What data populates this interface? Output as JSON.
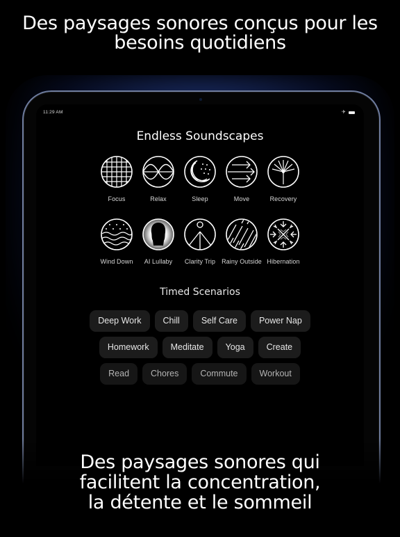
{
  "marketing": {
    "top_headline": "Des paysages sonores conçus pour les\nbesoins quotidiens",
    "bottom_headline": "Des paysages sonores qui\nfacilitent la concentration,\nla détente et le sommeil"
  },
  "status_bar": {
    "time": "11:29 AM",
    "icons": [
      "airplane-icon",
      "battery-icon"
    ]
  },
  "soundscapes": {
    "title": "Endless Soundscapes",
    "items": [
      {
        "label": "Focus",
        "icon": "grid-globe-icon"
      },
      {
        "label": "Relax",
        "icon": "wave-icon"
      },
      {
        "label": "Sleep",
        "icon": "moon-stars-icon"
      },
      {
        "label": "Move",
        "icon": "arrows-icon"
      },
      {
        "label": "Recovery",
        "icon": "dandelion-icon"
      },
      {
        "label": "Wind Down",
        "icon": "dots-waves-icon"
      },
      {
        "label": "AI Lullaby",
        "icon": "head-silhouette-icon"
      },
      {
        "label": "Clarity Trip",
        "icon": "figure-icon"
      },
      {
        "label": "Rainy Outside",
        "icon": "rain-icon"
      },
      {
        "label": "Hibernation",
        "icon": "snowflake-icon"
      }
    ]
  },
  "scenarios": {
    "title": "Timed Scenarios",
    "rows": [
      [
        "Deep Work",
        "Chill",
        "Self Care",
        "Power Nap"
      ],
      [
        "Homework",
        "Meditate",
        "Yoga",
        "Create"
      ],
      [
        "Read",
        "Chores",
        "Commute",
        "Workout"
      ]
    ]
  }
}
